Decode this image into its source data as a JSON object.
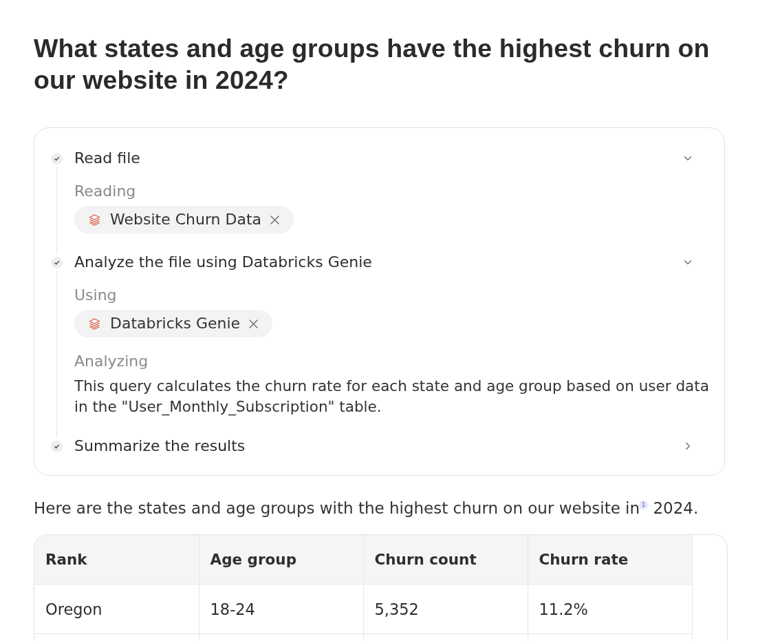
{
  "title": "What states and age groups have the highest churn on our website in 2024?",
  "steps": [
    {
      "title": "Read file",
      "done": true,
      "expanded": true,
      "details": [
        {
          "kind": "label",
          "text": "Reading"
        },
        {
          "kind": "chip",
          "text": "Website Churn Data"
        }
      ]
    },
    {
      "title": "Analyze the file using Databricks Genie",
      "done": true,
      "expanded": true,
      "details": [
        {
          "kind": "label",
          "text": "Using"
        },
        {
          "kind": "chip",
          "text": "Databricks Genie"
        },
        {
          "kind": "label",
          "text": "Analyzing"
        },
        {
          "kind": "paragraph",
          "text": "This query calculates the churn rate for each state and age group based on user data in the \"User_Monthly_Subscription\" table."
        }
      ]
    },
    {
      "title": "Summarize the results",
      "done": true,
      "expanded": false
    }
  ],
  "answer": {
    "text": "Here are the states and age groups with the highest churn on our website in$^{1}$ 2024."
  },
  "table": {
    "columns": [
      "Rank",
      "Age group",
      "Churn count",
      "Churn rate"
    ],
    "rows": [
      [
        "Oregon",
        "18-24",
        "5,352",
        "11.2%"
      ]
    ]
  }
}
